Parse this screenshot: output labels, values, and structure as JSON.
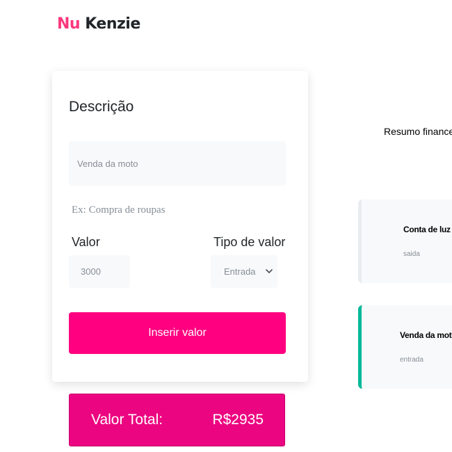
{
  "header": {
    "logo_part1": "Nu",
    "logo_part2": "Kenzie"
  },
  "form": {
    "description_label": "Descrição",
    "description_value": "Venda da moto",
    "description_hint": "Ex: Compra de roupas",
    "value_label": "Valor",
    "value_field_value": "3000",
    "type_label": "Tipo de valor",
    "type_selected": "Entrada",
    "submit_label": "Inserir valor"
  },
  "total": {
    "label": "Valor Total:",
    "amount": "R$2935"
  },
  "summary": {
    "title": "Resumo financeiro",
    "transactions": [
      {
        "title": "Conta de luz",
        "type": "saida",
        "accent_color": "#e9ecef"
      },
      {
        "title": "Venda da moto",
        "type": "entrada",
        "accent_color": "#03b898"
      }
    ]
  },
  "colors": {
    "brand_pink": "#ff0080",
    "total_bg": "#ec0580",
    "entrada_accent": "#03b898"
  }
}
